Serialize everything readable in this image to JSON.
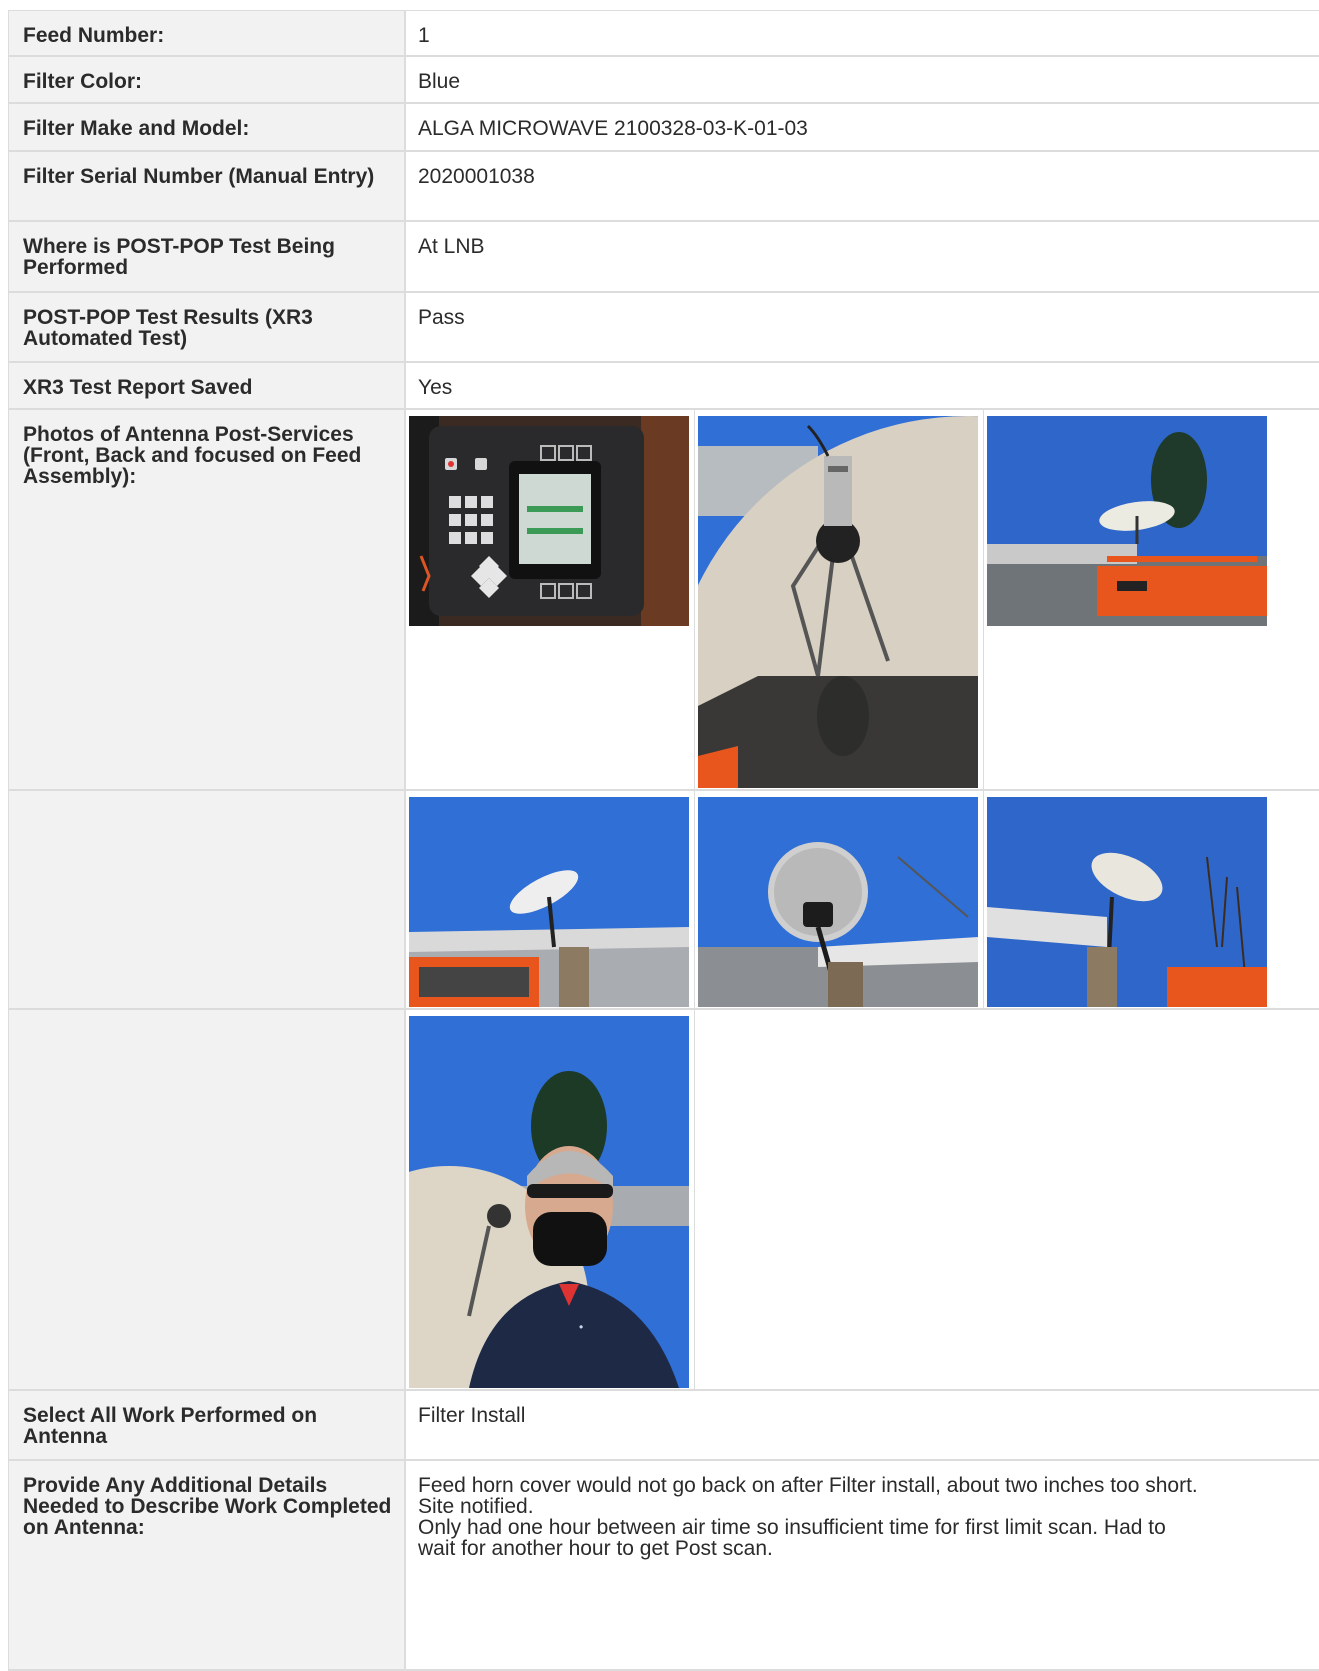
{
  "rows": [
    {
      "label": "Feed Number:",
      "value": "1"
    },
    {
      "label": "Filter Color:",
      "value": "Blue"
    },
    {
      "label": "Filter Make and Model:",
      "value": "ALGA MICROWAVE 2100328-03-K-01-03"
    },
    {
      "label": "Filter Serial Number (Manual Entry)",
      "value": "2020001038"
    },
    {
      "label": "Where is POST-POP Test Being Performed",
      "value": "At LNB"
    },
    {
      "label": "POST-POP Test Results (XR3 Automated Test)",
      "value": "Pass"
    },
    {
      "label": "XR3 Test Report Saved",
      "value": "Yes"
    }
  ],
  "photos_section": {
    "label": "Photos of Antenna Post-Services (Front, Back and focused on Feed Assembly):",
    "photos": [
      {
        "icon": "xr3-meter-photo"
      },
      {
        "icon": "feed-assembly-photo"
      },
      {
        "icon": "antenna-lift-photo"
      },
      {
        "icon": "antenna-building-photo"
      },
      {
        "icon": "antenna-back-photo"
      },
      {
        "icon": "antenna-trees-photo"
      },
      {
        "icon": "technician-selfie-photo"
      }
    ]
  },
  "work_performed": {
    "label": "Select All Work Performed on Antenna",
    "value": "Filter Install"
  },
  "additional_details": {
    "label": "Provide Any Additional Details Needed to Describe Work Completed on Antenna:",
    "lines": [
      "Feed horn cover would not go back on after Filter install, about two inches too short.",
      "Site notified.",
      "Only had one hour between air time so insufficient time for first limit scan. Had to",
      "wait for another hour to get Post scan."
    ]
  },
  "colors": {
    "label_bg": "#f2f2f2",
    "border": "#dcdcdc",
    "text": "#2b2b2b",
    "sky": "#2f6fd6",
    "lift_orange": "#e8561e"
  }
}
